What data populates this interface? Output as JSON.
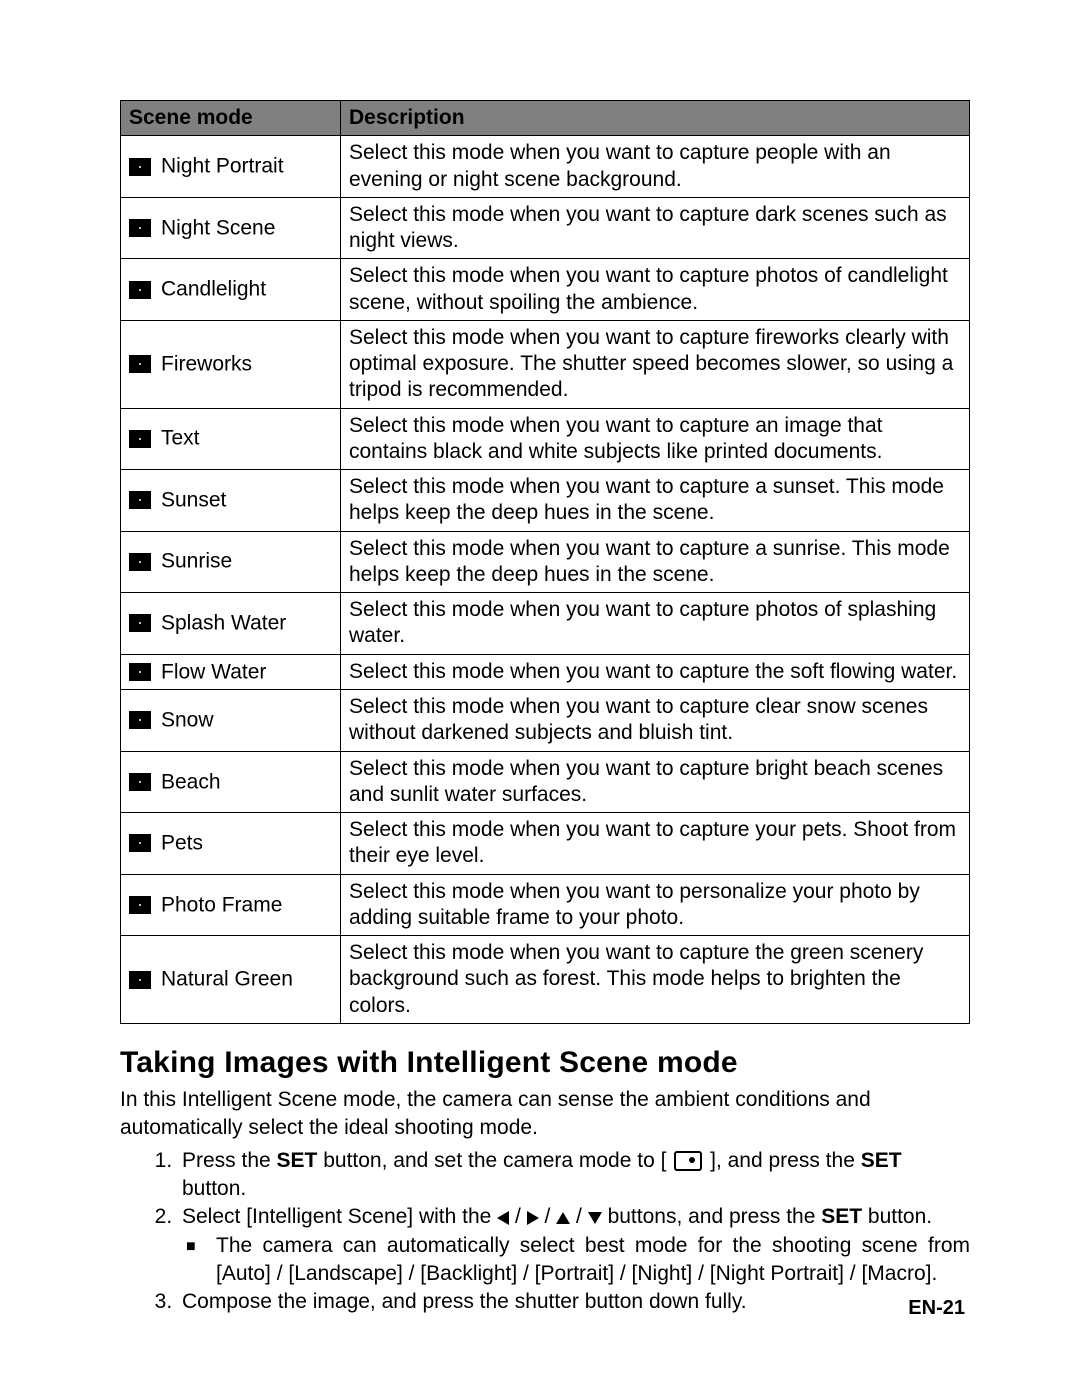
{
  "table": {
    "header": {
      "mode": "Scene mode",
      "desc": "Description"
    },
    "rows": [
      {
        "label": "Night Portrait",
        "desc": "Select this mode when you want to capture people with an evening or night scene background."
      },
      {
        "label": "Night Scene",
        "desc": "Select this mode when you want to capture dark scenes such as night views."
      },
      {
        "label": "Candlelight",
        "desc": "Select this mode when you want to capture photos of candlelight scene, without spoiling the ambience."
      },
      {
        "label": "Fireworks",
        "desc": "Select this mode when you want to capture fireworks clearly with optimal exposure. The shutter speed becomes slower, so using a tripod is recommended."
      },
      {
        "label": "Text",
        "desc": "Select this mode when you want to capture an image that contains black and white subjects like printed documents."
      },
      {
        "label": "Sunset",
        "desc": "Select this mode when you want to capture a sunset. This mode helps keep the deep hues in the scene."
      },
      {
        "label": "Sunrise",
        "desc": "Select this mode when you want to capture a sunrise. This mode helps keep the deep hues in the scene."
      },
      {
        "label": "Splash Water",
        "desc": "Select this mode when you want to capture photos of splashing water."
      },
      {
        "label": "Flow Water",
        "desc": "Select this mode when you want to capture the soft flowing water."
      },
      {
        "label": "Snow",
        "desc": "Select this mode when you want to capture clear snow scenes without darkened subjects and bluish tint."
      },
      {
        "label": "Beach",
        "desc": "Select this mode when you want to capture bright beach scenes and sunlit water surfaces."
      },
      {
        "label": "Pets",
        "desc": "Select this mode when you want to capture your pets. Shoot from their eye level."
      },
      {
        "label": "Photo Frame",
        "desc": "Select this mode when you want to personalize your photo by adding  suitable frame to your photo."
      },
      {
        "label": "Natural Green",
        "desc": "Select this mode when you want to capture the green scenery background such as forest. This mode helps to brighten the colors."
      }
    ]
  },
  "section": {
    "title": "Taking Images with Intelligent Scene mode",
    "intro": "In this Intelligent Scene mode, the camera can sense the ambient conditions and automatically select the ideal shooting mode.",
    "step1_a": "Press the ",
    "step1_b": "SET",
    "step1_c": " button, and set the camera mode to [ ",
    "step1_d": " ], and press the ",
    "step1_e": "SET",
    "step1_f": " button.",
    "step2_a": "Select [Intelligent Scene] with the ",
    "step2_b": " buttons, and press the ",
    "step2_c": "SET",
    "step2_d": " button.",
    "sub_a": "The camera can automatically select best mode for the shooting scene from [Auto] / [Landscape] / [Backlight] / [Portrait] / [Night] / [Night Portrait] / [Macro].",
    "step3": "Compose the image, and press the shutter button down fully."
  },
  "page_num": "EN-21"
}
